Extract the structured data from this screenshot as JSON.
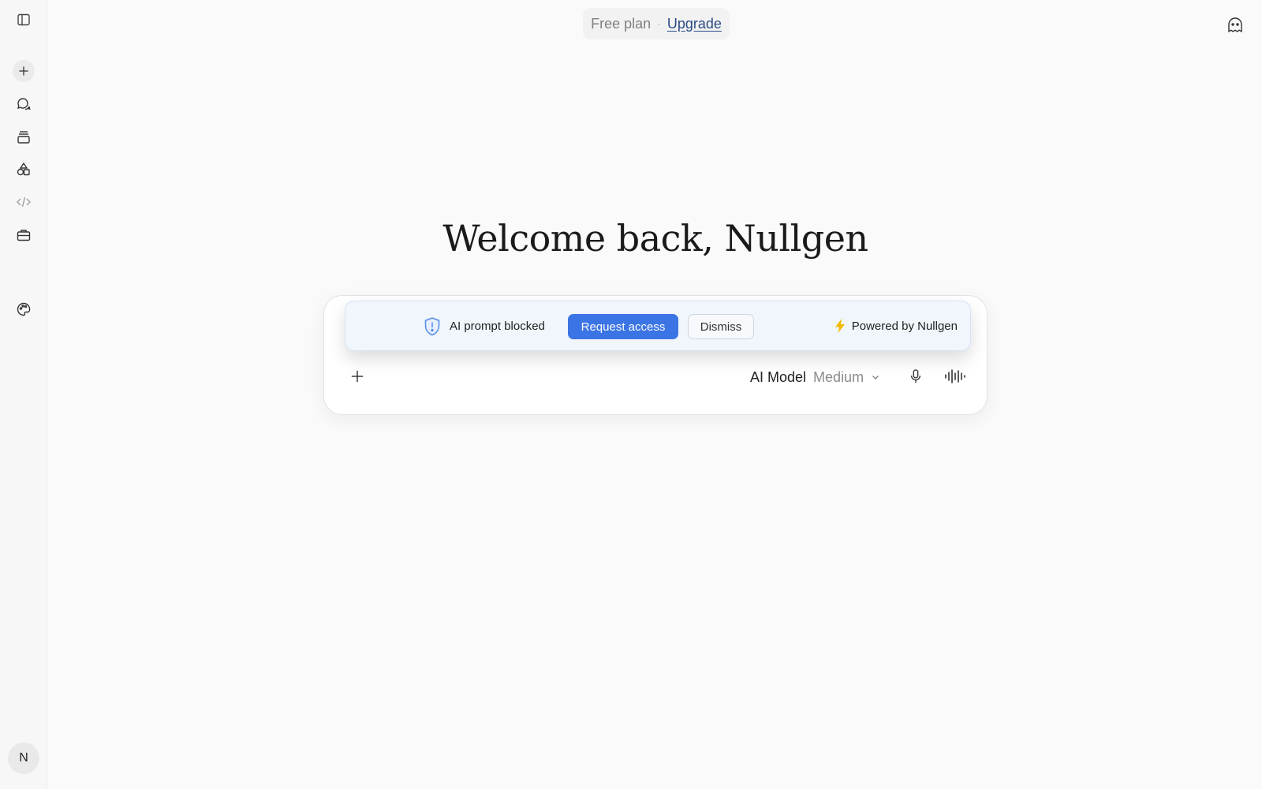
{
  "header": {
    "plan_label": "Free plan",
    "separator": "·",
    "upgrade_label": "Upgrade"
  },
  "sidebar": {
    "items": [
      {
        "name": "toggle-sidebar",
        "icon": "sidebar-icon"
      },
      {
        "name": "new-chat",
        "icon": "plus-icon"
      },
      {
        "name": "chats",
        "icon": "chat-bubbles-icon"
      },
      {
        "name": "projects",
        "icon": "stack-icon"
      },
      {
        "name": "artifacts",
        "icon": "shapes-icon"
      },
      {
        "name": "code",
        "icon": "code-icon"
      },
      {
        "name": "tools",
        "icon": "briefcase-icon"
      },
      {
        "name": "appearance",
        "icon": "palette-icon"
      }
    ],
    "avatar_initial": "N"
  },
  "main": {
    "greeting": "Welcome back, Nullgen"
  },
  "banner": {
    "blocked_text": "AI prompt blocked",
    "request_label": "Request access",
    "dismiss_label": "Dismiss",
    "powered_text": "Powered by Nullgen"
  },
  "composer": {
    "model_label": "AI Model",
    "model_value": "Medium"
  },
  "colors": {
    "accent": "#3b74e4",
    "upgrade_link": "#2b4c86",
    "bolt": "#f5b800",
    "shield": "#5b8fe8"
  }
}
